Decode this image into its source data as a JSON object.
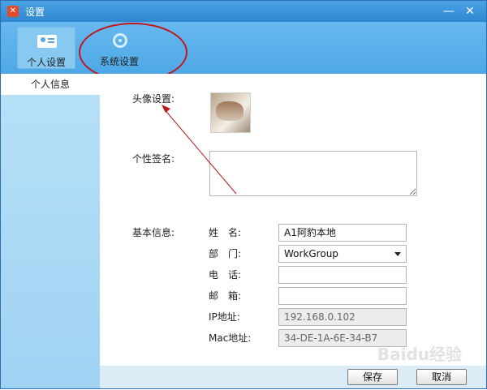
{
  "window": {
    "title": "设置",
    "logo_icon": "x-logo-icon",
    "min_glyph": "—",
    "close_glyph": "✕"
  },
  "toolbar": {
    "tabs": [
      {
        "label": "个人设置",
        "icon": "user-card-icon",
        "active": true
      },
      {
        "label": "系统设置",
        "icon": "gear-icon",
        "active": false
      }
    ]
  },
  "sidebar": {
    "items": [
      {
        "label": "个人信息",
        "selected": true
      }
    ]
  },
  "profile": {
    "avatar_label": "头像设置:",
    "signature_label": "个性签名:",
    "signature_value": "",
    "basic_label": "基本信息:",
    "fields": {
      "name": {
        "label": "姓　名:",
        "value": "A1阿豹本地"
      },
      "department": {
        "label": "部　门:",
        "value": "WorkGroup"
      },
      "phone": {
        "label": "电　话:",
        "value": ""
      },
      "email": {
        "label": "邮　箱:",
        "value": ""
      },
      "ip": {
        "label": "IP地址:",
        "value": "192.168.0.102"
      },
      "mac": {
        "label": "Mac地址:",
        "value": "34-DE-1A-6E-34-B7"
      }
    }
  },
  "footer": {
    "save_label": "保存",
    "cancel_label": "取消"
  },
  "annotations": {
    "color": "#c2151c"
  },
  "watermark": {
    "text": "Baidu经验"
  }
}
